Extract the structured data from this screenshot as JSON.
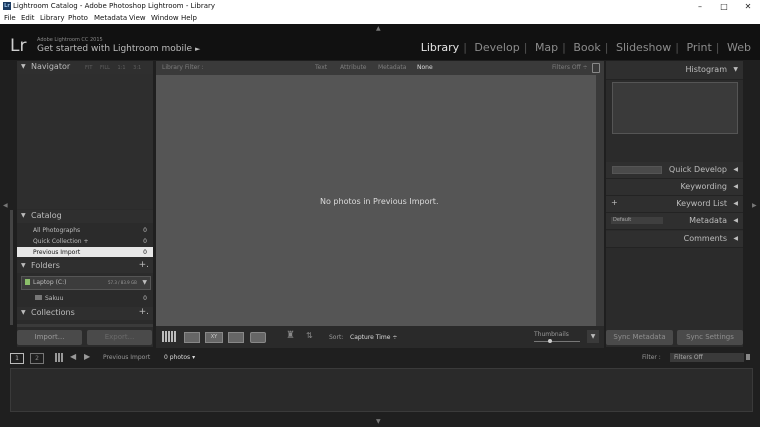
{
  "window": {
    "title": "Lightroom Catalog - Adobe Photoshop Lightroom - Library",
    "app_icon_text": "Lr",
    "controls": [
      "–",
      "□",
      "✕"
    ]
  },
  "menu": [
    "File",
    "Edit",
    "Library",
    "Photo",
    "Metadata",
    "View",
    "Window",
    "Help"
  ],
  "identity": {
    "logo": "Lr",
    "version": "Adobe Lightroom CC 2015",
    "mobile": "Get started with Lightroom mobile",
    "mobile_arrow": "►"
  },
  "modules": [
    "Library",
    "Develop",
    "Map",
    "Book",
    "Slideshow",
    "Print",
    "Web"
  ],
  "active_module": "Library",
  "left": {
    "navigator": {
      "label": "Navigator",
      "zoom_options": [
        "FIT",
        "FILL",
        "1:1",
        "3:1"
      ]
    },
    "catalog": {
      "label": "Catalog",
      "items": [
        {
          "name": "All Photographs",
          "count": "0"
        },
        {
          "name": "Quick Collection +",
          "count": "0"
        },
        {
          "name": "Previous Import",
          "count": "0"
        }
      ]
    },
    "folders": {
      "label": "Folders",
      "volume": {
        "name": "Laptop (C:)",
        "usage": "57.3 / 83.9 GB"
      },
      "items": [
        {
          "name": "Sakuu",
          "count": "0"
        }
      ]
    },
    "collections": {
      "label": "Collections"
    },
    "import_label": "Import...",
    "export_label": "Export..."
  },
  "filter": {
    "label": "Library Filter :",
    "options": [
      "Text",
      "Attribute",
      "Metadata",
      "None"
    ],
    "active": "None",
    "status": "Filters Off ÷"
  },
  "center": {
    "empty_message": "No photos in Previous Import."
  },
  "toolbar": {
    "sort_label": "Sort:",
    "sort_value": "Capture Time ÷",
    "thumbnails_label": "Thumbnails"
  },
  "right": {
    "histogram": "Histogram",
    "quick_develop": "Quick Develop",
    "keywording": "Keywording",
    "keyword_list": "Keyword List",
    "metadata": "Metadata",
    "metadata_preset": "Default",
    "comments": "Comments",
    "sync_metadata": "Sync Metadata",
    "sync_settings": "Sync Settings"
  },
  "filmstrip": {
    "page1": "1",
    "page2": "2",
    "source": "Previous Import",
    "count": "0 photos ▾",
    "filter_label": "Filter :",
    "filter_value": "Filters Off"
  }
}
